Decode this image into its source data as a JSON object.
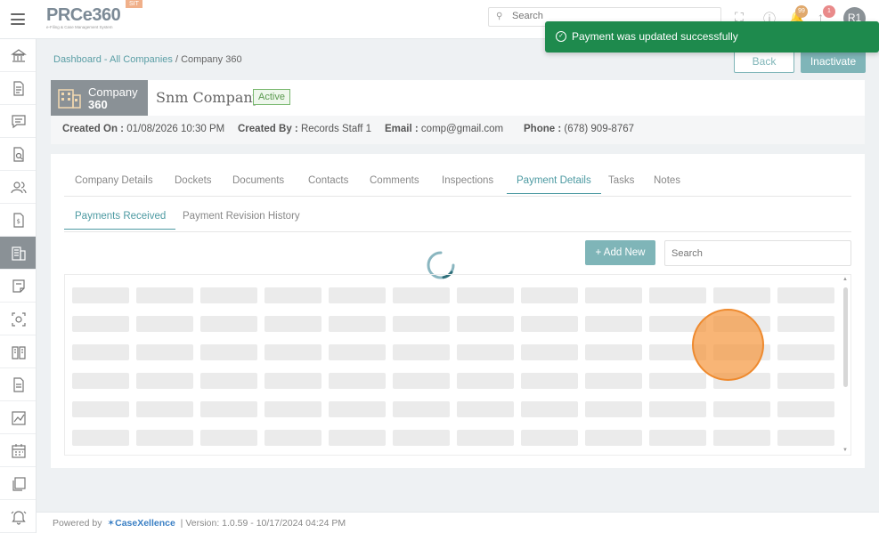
{
  "app": {
    "logo_text": "PRCe360",
    "logo_tagline": "e-Filing & Case Management System",
    "env_badge": "SIT"
  },
  "topbar": {
    "search_placeholder": "Search",
    "notifications_count": "99",
    "alerts_count": "1",
    "avatar_initials": "R1"
  },
  "toast": {
    "message": "Payment was updated successfully",
    "color": "#1e8a4d"
  },
  "sidebar": {
    "items": [
      {
        "icon": "bank-icon"
      },
      {
        "icon": "document-icon"
      },
      {
        "icon": "chat-icon"
      },
      {
        "icon": "document-search-icon"
      },
      {
        "icon": "users-icon"
      },
      {
        "icon": "invoice-icon"
      },
      {
        "icon": "building-icon",
        "active": true
      },
      {
        "icon": "note-icon"
      },
      {
        "icon": "scan-icon"
      },
      {
        "icon": "book-icon"
      },
      {
        "icon": "file-icon"
      },
      {
        "icon": "chart-icon"
      },
      {
        "icon": "calendar-icon"
      },
      {
        "icon": "copy-icon"
      },
      {
        "icon": "bell-icon"
      }
    ]
  },
  "breadcrumb": {
    "link": "Dashboard - All Companies",
    "separator": " / ",
    "current": "Company 360"
  },
  "actions": {
    "back_label": "Back",
    "inactivate_label": "Inactivate"
  },
  "company": {
    "tile_line1": "Company",
    "tile_line2": "360",
    "name": "Snm Company",
    "status": "Active",
    "created_on_label": "Created On :",
    "created_on_value": "01/08/2026 10:30 PM",
    "created_by_label": "Created By :",
    "created_by_value": "Records Staff 1",
    "email_label": "Email :",
    "email_value": "comp@gmail.com",
    "phone_label": "Phone :",
    "phone_value": "(678) 909-8767"
  },
  "tabs": [
    "Company Details",
    "Dockets",
    "Documents",
    "Contacts",
    "Comments",
    "Inspections",
    "Payment Details",
    "Tasks",
    "Notes"
  ],
  "active_tab": "Payment Details",
  "subtabs": [
    "Payments Received",
    "Payment Revision History"
  ],
  "active_subtab": "Payments Received",
  "table_toolbar": {
    "add_label": "+ Add New",
    "search_placeholder": "Search"
  },
  "footer": {
    "powered_by": "Powered by",
    "brand": "CaseXellence",
    "version": "|  Version: 1.0.59 - 10/17/2024 04:24 PM"
  },
  "colors": {
    "accent": "#7fb5b8",
    "tab_active": "#4d9aa2",
    "sidebar_active": "#8a9196"
  }
}
